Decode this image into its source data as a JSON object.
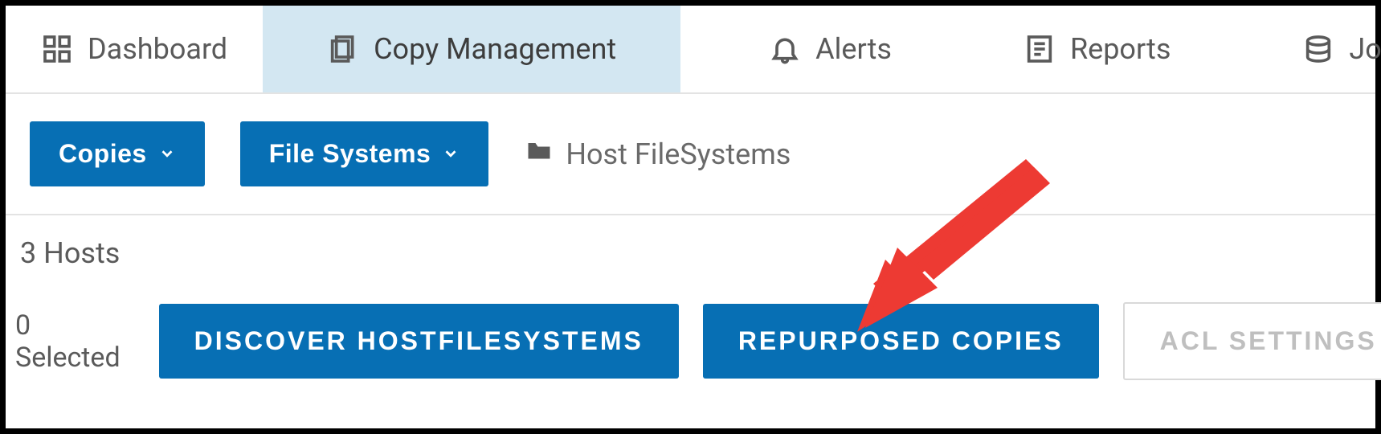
{
  "tabs": {
    "dashboard": "Dashboard",
    "copy_management": "Copy Management",
    "alerts": "Alerts",
    "reports": "Reports",
    "jobs": "Jobs"
  },
  "subbar": {
    "copies_label": "Copies",
    "filesystems_label": "File Systems",
    "breadcrumb": "Host FileSystems"
  },
  "content": {
    "host_count": "3 Hosts",
    "selected_count": "0 Selected",
    "discover_btn": "DISCOVER HOSTFILESYSTEMS",
    "repurposed_btn": "REPURPOSED COPIES",
    "acl_btn": "ACL SETTINGS"
  },
  "colors": {
    "primary": "#076fb4",
    "tab_active_bg": "#d3e7f2",
    "annotation": "#ed3a33"
  }
}
